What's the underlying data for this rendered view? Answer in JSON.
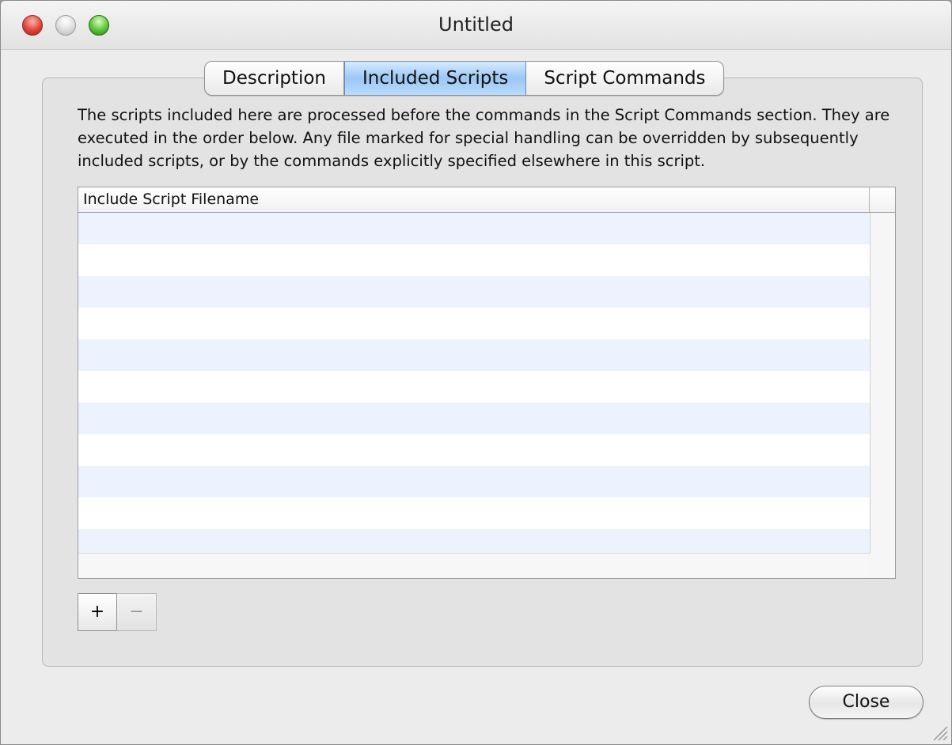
{
  "window": {
    "title": "Untitled"
  },
  "tabs": [
    {
      "label": "Description",
      "active": false
    },
    {
      "label": "Included Scripts",
      "active": true
    },
    {
      "label": "Script Commands",
      "active": false
    }
  ],
  "description": "The scripts included here are processed before the commands in the Script Commands section. They are executed in the order below. Any file marked for special handling can be overridden by subsequently included scripts, or by the commands explicitly specified elsewhere in this script.",
  "table": {
    "columns": [
      "Include Script Filename"
    ],
    "rows": []
  },
  "buttons": {
    "add_label": "+",
    "remove_label": "−",
    "close_label": "Close"
  },
  "colors": {
    "row_stripe": "#edf3fe",
    "tab_active": "#9cc7f3",
    "close_light": "#e0443a",
    "minimize_light": "#dcdcdc",
    "zoom_light": "#5cc23a"
  },
  "icons": {
    "close_window": "close-window-icon",
    "minimize_window": "minimize-window-icon",
    "zoom_window": "zoom-window-icon",
    "resize_grip": "resize-grip-icon"
  }
}
